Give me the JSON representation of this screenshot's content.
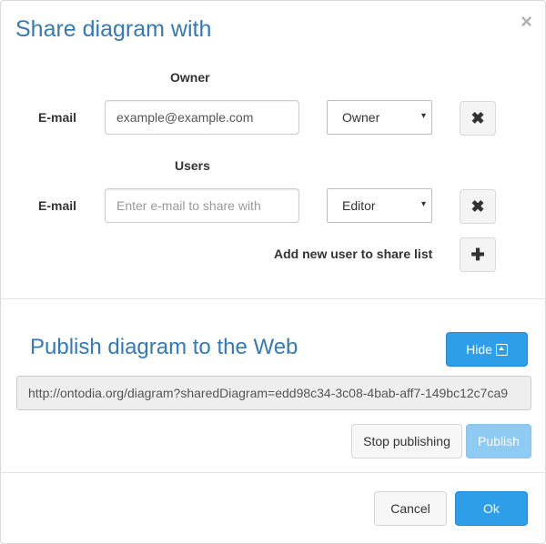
{
  "dialog": {
    "title": "Share diagram with",
    "close_glyph": "×"
  },
  "owner_section": {
    "heading": "Owner",
    "email_label": "E-mail",
    "email_value": "example@example.com",
    "role_value": "Owner",
    "remove_icon": "remove-icon"
  },
  "users_section": {
    "heading": "Users",
    "email_label": "E-mail",
    "email_placeholder": "Enter e-mail to share with",
    "role_value": "Editor",
    "remove_icon": "remove-icon"
  },
  "add_user": {
    "label": "Add new user to share list",
    "icon": "plus-icon"
  },
  "publish": {
    "title": "Publish diagram to the Web",
    "hide_label": "Hide",
    "hide_icon": "collapse-up-icon",
    "link": "http://ontodia.org/diagram?sharedDiagram=edd98c34-3c08-4bab-aff7-149bc12c7ca9",
    "stop_label": "Stop publishing",
    "publish_label": "Publish"
  },
  "footer": {
    "cancel_label": "Cancel",
    "ok_label": "Ok"
  },
  "colors": {
    "title": "#337ab7",
    "primary": "#2e9ee8",
    "primary_disabled": "#8ecbf3"
  },
  "glyphs": {
    "caret": "▾",
    "remove": "✖",
    "plus": "✚"
  }
}
